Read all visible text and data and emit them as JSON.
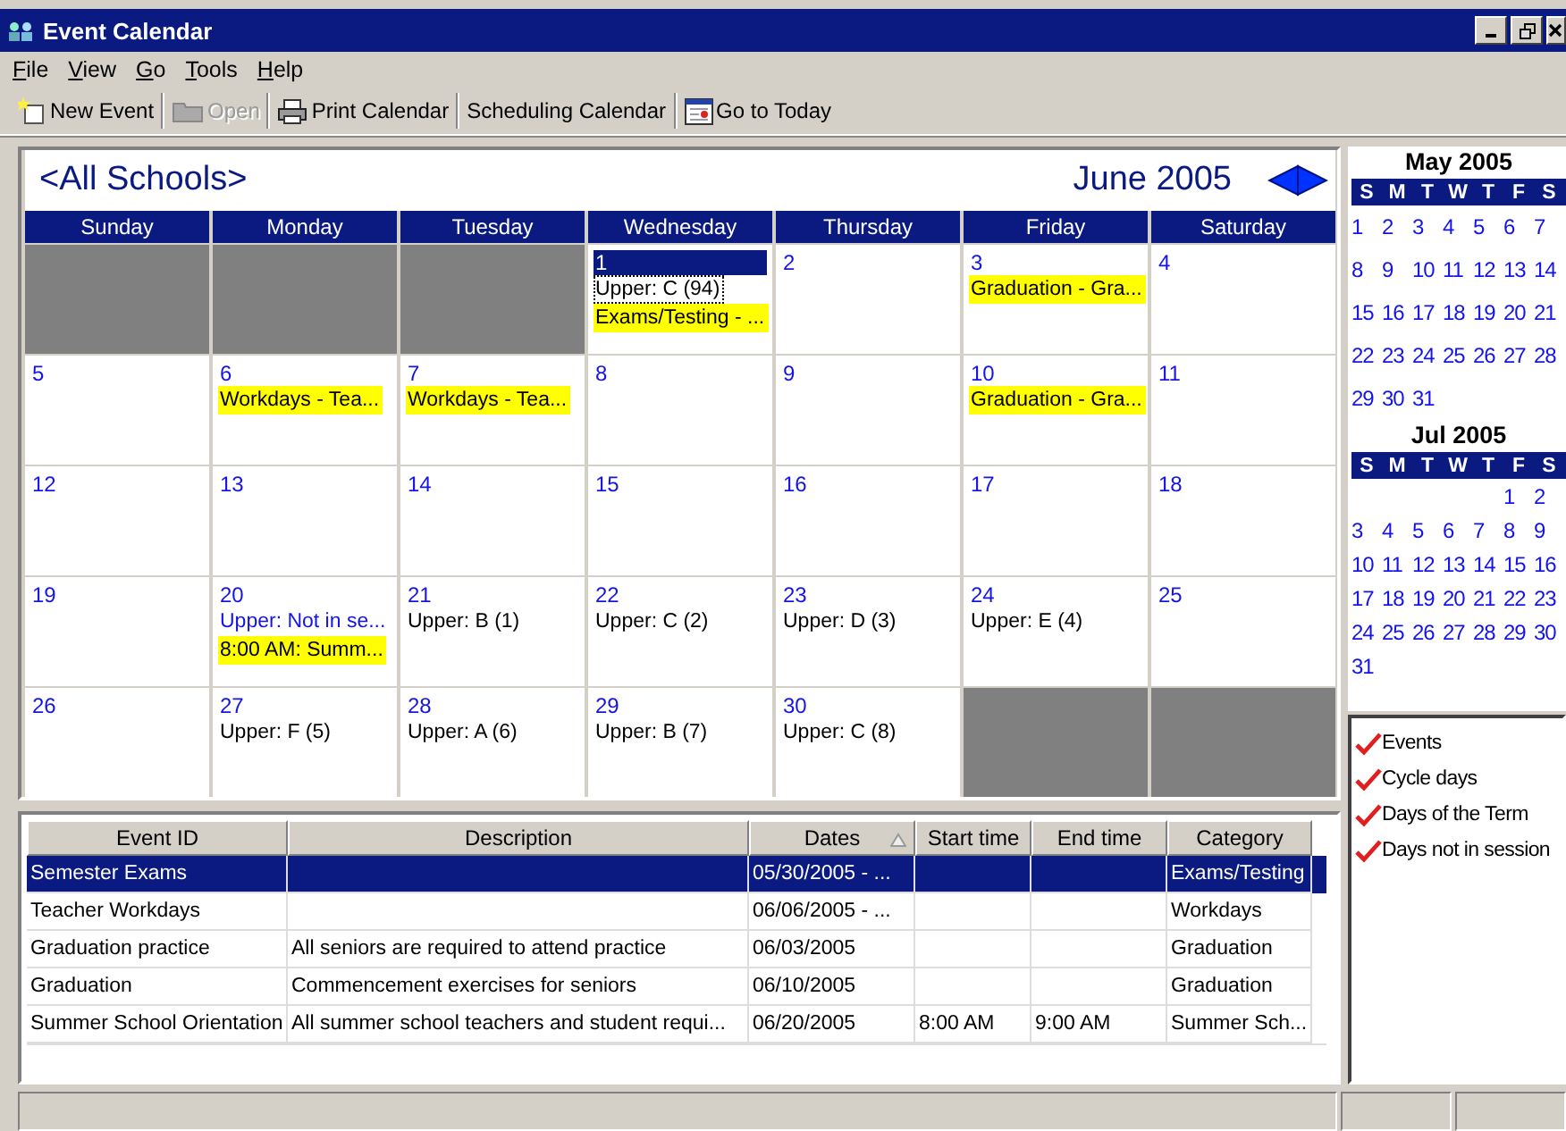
{
  "window": {
    "title": "Event Calendar"
  },
  "menu": [
    "File",
    "View",
    "Go",
    "Tools",
    "Help"
  ],
  "toolbar": [
    {
      "label": "New Event",
      "disabled": false
    },
    {
      "label": "Open",
      "disabled": true
    },
    {
      "label": "Print Calendar",
      "disabled": false
    },
    {
      "label": "Scheduling Calendar",
      "disabled": false
    },
    {
      "label": "Go to Today",
      "disabled": false
    }
  ],
  "calendar": {
    "filter": "<All Schools>",
    "month": "June 2005",
    "weekdays": [
      "Sunday",
      "Monday",
      "Tuesday",
      "Wednesday",
      "Thursday",
      "Friday",
      "Saturday"
    ],
    "weeks": [
      [
        {
          "kind": "blank"
        },
        {
          "kind": "blank"
        },
        {
          "kind": "blank"
        },
        {
          "kind": "day",
          "day": "1",
          "selected": true,
          "entries": [
            {
              "kind": "cycle_focus",
              "text": "Upper: C (94)"
            },
            {
              "kind": "event",
              "text": "Exams/Testing - ..."
            }
          ]
        },
        {
          "kind": "day",
          "day": "2",
          "selected": false
        },
        {
          "kind": "day",
          "day": "3",
          "selected": false,
          "entries": [
            {
              "kind": "event",
              "text": "Graduation - Gra..."
            }
          ]
        },
        {
          "kind": "day",
          "day": "4",
          "selected": false
        }
      ],
      [
        {
          "kind": "day",
          "day": "5",
          "selected": false
        },
        {
          "kind": "day",
          "day": "6",
          "selected": false,
          "entries": [
            {
              "kind": "event",
              "text": "Workdays - Tea..."
            }
          ]
        },
        {
          "kind": "day",
          "day": "7",
          "selected": false,
          "entries": [
            {
              "kind": "event",
              "text": "Workdays - Tea..."
            }
          ]
        },
        {
          "kind": "day",
          "day": "8",
          "selected": false
        },
        {
          "kind": "day",
          "day": "9",
          "selected": false
        },
        {
          "kind": "day",
          "day": "10",
          "selected": false,
          "entries": [
            {
              "kind": "event",
              "text": "Graduation - Gra..."
            }
          ]
        },
        {
          "kind": "day",
          "day": "11",
          "selected": false
        }
      ],
      [
        {
          "kind": "day",
          "day": "12",
          "selected": false
        },
        {
          "kind": "day",
          "day": "13",
          "selected": false
        },
        {
          "kind": "day",
          "day": "14",
          "selected": false
        },
        {
          "kind": "day",
          "day": "15",
          "selected": false
        },
        {
          "kind": "day",
          "day": "16",
          "selected": false
        },
        {
          "kind": "day",
          "day": "17",
          "selected": false
        },
        {
          "kind": "day",
          "day": "18",
          "selected": false
        }
      ],
      [
        {
          "kind": "day",
          "day": "19",
          "selected": false
        },
        {
          "kind": "day",
          "day": "20",
          "selected": false,
          "entries": [
            {
              "kind": "off",
              "text": "Upper: Not in se..."
            },
            {
              "kind": "event",
              "text": "8:00 AM: Summ..."
            }
          ]
        },
        {
          "kind": "day",
          "day": "21",
          "selected": false,
          "entries": [
            {
              "kind": "cycle",
              "text": "Upper: B (1)"
            }
          ]
        },
        {
          "kind": "day",
          "day": "22",
          "selected": false,
          "entries": [
            {
              "kind": "cycle",
              "text": "Upper: C (2)"
            }
          ]
        },
        {
          "kind": "day",
          "day": "23",
          "selected": false,
          "entries": [
            {
              "kind": "cycle",
              "text": "Upper: D (3)"
            }
          ]
        },
        {
          "kind": "day",
          "day": "24",
          "selected": false,
          "entries": [
            {
              "kind": "cycle",
              "text": "Upper: E (4)"
            }
          ]
        },
        {
          "kind": "day",
          "day": "25",
          "selected": false
        }
      ],
      [
        {
          "kind": "day",
          "day": "26",
          "selected": false
        },
        {
          "kind": "day",
          "day": "27",
          "selected": false,
          "entries": [
            {
              "kind": "cycle",
              "text": "Upper: F (5)"
            }
          ]
        },
        {
          "kind": "day",
          "day": "28",
          "selected": false,
          "entries": [
            {
              "kind": "cycle",
              "text": "Upper: A (6)"
            }
          ]
        },
        {
          "kind": "day",
          "day": "29",
          "selected": false,
          "entries": [
            {
              "kind": "cycle",
              "text": "Upper: B (7)"
            }
          ]
        },
        {
          "kind": "day",
          "day": "30",
          "selected": false,
          "entries": [
            {
              "kind": "cycle",
              "text": "Upper: C (8)"
            }
          ]
        },
        {
          "kind": "blank"
        },
        {
          "kind": "blank"
        }
      ]
    ]
  },
  "table": {
    "columns": [
      {
        "label": "Event ID",
        "sorted": false
      },
      {
        "label": "Description",
        "sorted": false
      },
      {
        "label": "Dates",
        "sorted": true
      },
      {
        "label": "Start time",
        "sorted": false
      },
      {
        "label": "End time",
        "sorted": false
      },
      {
        "label": "Category",
        "sorted": false
      }
    ],
    "rows": [
      {
        "selected": true,
        "event_id": "Semester Exams",
        "dates": "05/30/2005 - ...",
        "category": "Exams/Testing"
      },
      {
        "selected": false,
        "event_id": "Teacher Workdays",
        "dates": "06/06/2005 - ...",
        "category": "Workdays"
      },
      {
        "selected": false,
        "event_id": "Graduation practice",
        "description": "All seniors are required to attend practice",
        "dates": "06/03/2005",
        "category": "Graduation"
      },
      {
        "selected": false,
        "event_id": "Graduation",
        "description": "Commencement exercises for seniors",
        "dates": "06/10/2005",
        "category": "Graduation"
      },
      {
        "selected": false,
        "event_id": "Summer School Orientation",
        "description": "All summer school teachers and student requi...",
        "dates": "06/20/2005",
        "start_time": "8:00 AM",
        "end_time": "9:00 AM",
        "category": "Summer Sch..."
      }
    ]
  },
  "mini_calendars": [
    {
      "title": "May 2005",
      "weekdays": [
        "S",
        "M",
        "T",
        "W",
        "T",
        "F",
        "S"
      ],
      "weeks": [
        [
          "1",
          "2",
          "3",
          "4",
          "5",
          "6",
          "7"
        ],
        [
          "8",
          "9",
          "10",
          "11",
          "12",
          "13",
          "14"
        ],
        [
          "15",
          "16",
          "17",
          "18",
          "19",
          "20",
          "21"
        ],
        [
          "22",
          "23",
          "24",
          "25",
          "26",
          "27",
          "28"
        ],
        [
          "29",
          "30",
          "31"
        ]
      ]
    },
    {
      "title": "Jul 2005",
      "weekdays": [
        "S",
        "M",
        "T",
        "W",
        "T",
        "F",
        "S"
      ],
      "weeks": [
        [
          "1",
          "2"
        ],
        [
          "3",
          "4",
          "5",
          "6",
          "7",
          "8",
          "9"
        ],
        [
          "10",
          "11",
          "12",
          "13",
          "14",
          "15",
          "16"
        ],
        [
          "17",
          "18",
          "19",
          "20",
          "21",
          "22",
          "23"
        ],
        [
          "24",
          "25",
          "26",
          "27",
          "28",
          "29",
          "30"
        ],
        [
          "31"
        ]
      ]
    }
  ],
  "legend": [
    {
      "label": "Events",
      "checked": true
    },
    {
      "label": "Cycle days",
      "checked": true
    },
    {
      "label": "Days of the Term",
      "checked": true
    },
    {
      "label": "Days not in session",
      "checked": true
    }
  ]
}
